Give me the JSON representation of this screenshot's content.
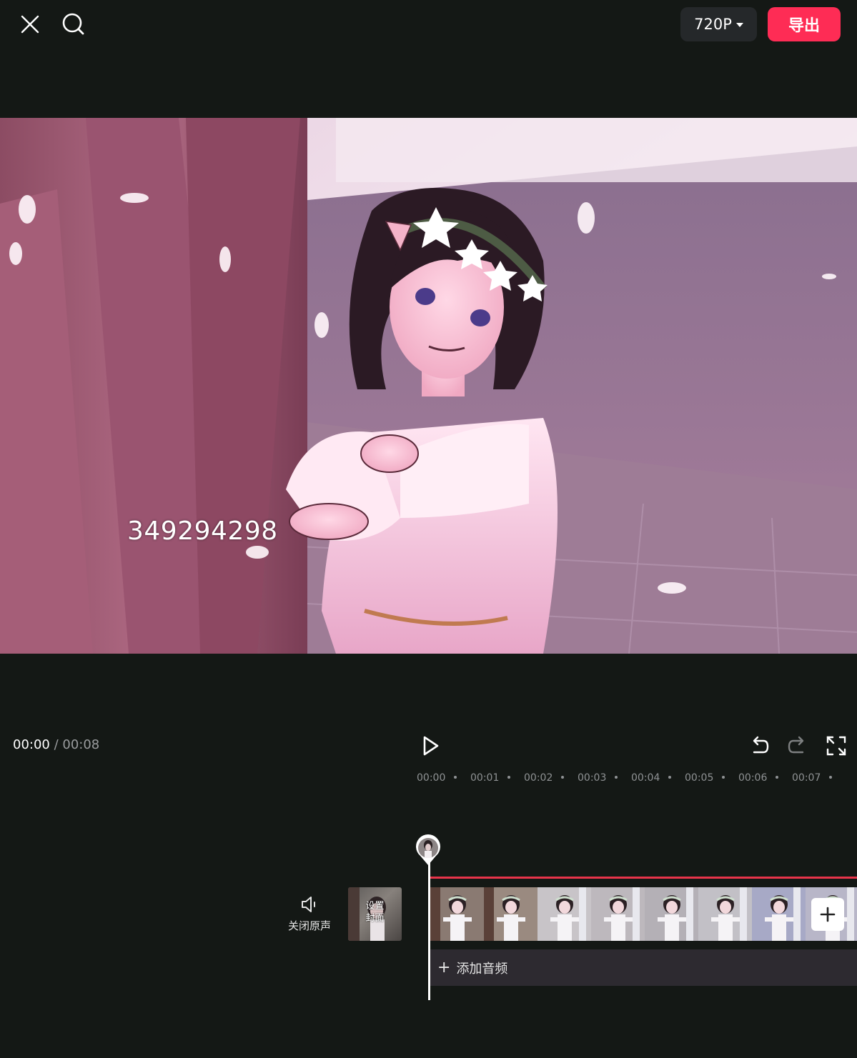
{
  "header": {
    "resolution_label": "720P",
    "export_label": "导出"
  },
  "preview": {
    "overlay_text": "349294298"
  },
  "playback": {
    "current_time": "00:00",
    "separator": " / ",
    "total_time": "00:08"
  },
  "ruler": {
    "ticks": [
      "00:00",
      "00:01",
      "00:02",
      "00:03",
      "00:04",
      "00:05",
      "00:06",
      "00:07"
    ]
  },
  "track": {
    "mute_label": "关闭原声",
    "cover_label_line1": "设置",
    "cover_label_line2": "封面",
    "add_audio_label": "添加音频"
  },
  "colors": {
    "background": "#141815",
    "accent": "#fe2c55",
    "track_line": "#e8344a"
  }
}
